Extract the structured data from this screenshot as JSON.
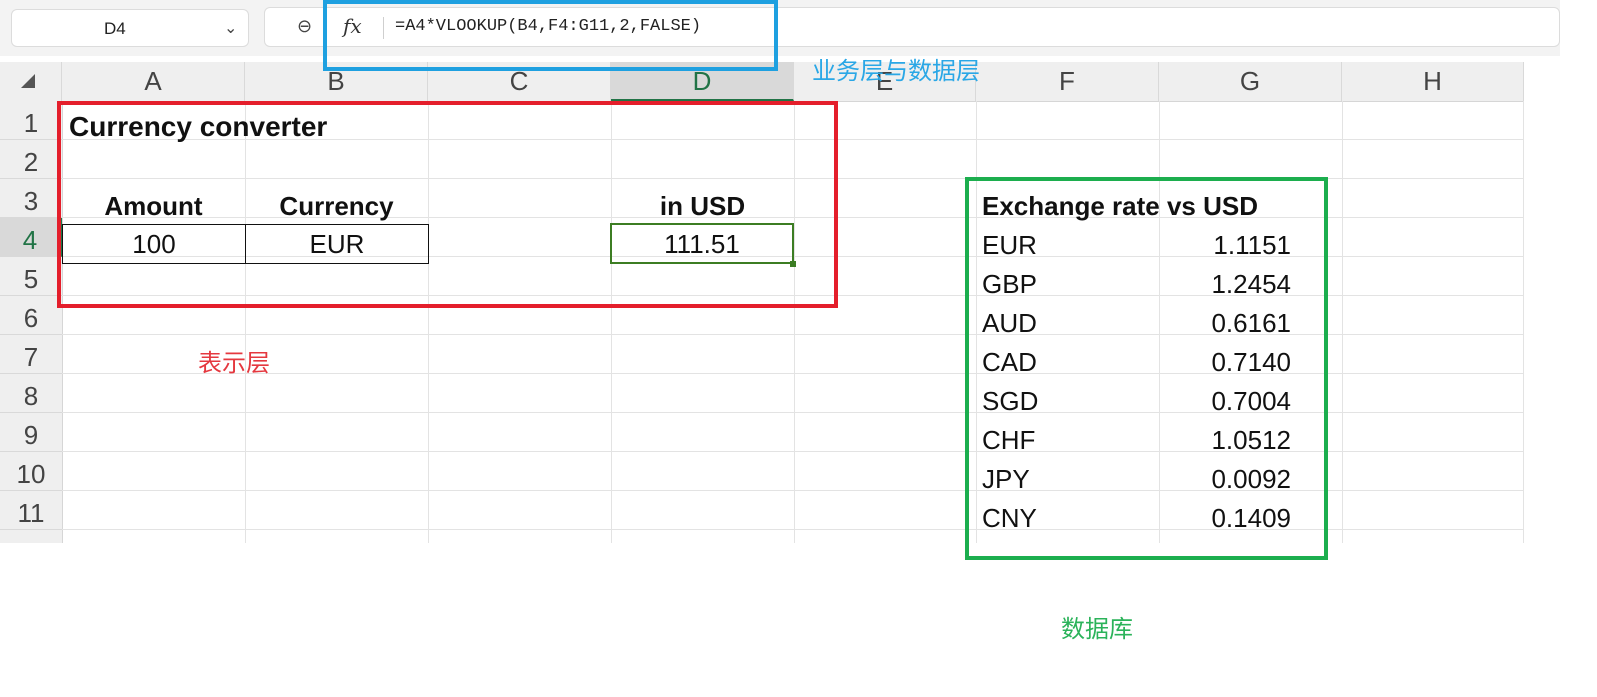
{
  "name_box": {
    "value": "D4",
    "dropdown_glyph": "⌄"
  },
  "formula_bar": {
    "zoom_glyph": "⊖",
    "fx_label": "fx",
    "formula": "=A4*VLOOKUP(B4,F4:G11,2,FALSE)"
  },
  "columns": [
    "A",
    "B",
    "C",
    "D",
    "E",
    "F",
    "G",
    "H"
  ],
  "rows": [
    "1",
    "2",
    "3",
    "4",
    "5",
    "6",
    "7",
    "8",
    "9",
    "10",
    "11"
  ],
  "selected_cell": "D4",
  "cells": {
    "title": "Currency converter",
    "amount_header": "Amount",
    "currency_header": "Currency",
    "usd_header": "in USD",
    "amount_value": "100",
    "currency_value": "EUR",
    "usd_value": "111.51"
  },
  "rates_table": {
    "header": "Exchange rate vs USD",
    "rows": [
      {
        "code": "EUR",
        "rate": "1.1151"
      },
      {
        "code": "GBP",
        "rate": "1.2454"
      },
      {
        "code": "AUD",
        "rate": "0.6161"
      },
      {
        "code": "CAD",
        "rate": "0.7140"
      },
      {
        "code": "SGD",
        "rate": "0.7004"
      },
      {
        "code": "CHF",
        "rate": "1.0512"
      },
      {
        "code": "JPY",
        "rate": "0.0092"
      },
      {
        "code": "CNY",
        "rate": "0.1409"
      }
    ]
  },
  "annotations": {
    "business_data_layer": "业务层与数据层",
    "presentation_layer": "表示层",
    "database": "数据库"
  },
  "colors": {
    "blue_annotation": "#1ea0e0",
    "red_annotation": "#e41e2b",
    "green_annotation": "#1cae4e",
    "active_cell": "#3c7d23"
  }
}
